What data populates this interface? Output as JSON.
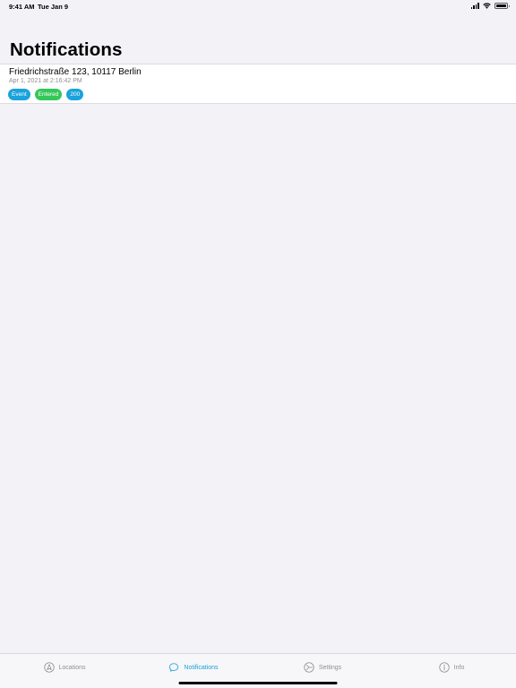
{
  "status_bar": {
    "time": "9:41 AM",
    "date": "Tue Jan 9"
  },
  "page": {
    "title": "Notifications"
  },
  "notifications": [
    {
      "title": "Friedrichstraße 123, 10117 Berlin",
      "subtitle": "Apr 1, 2021 at 2:16:42 PM",
      "badges": [
        {
          "label": "Event",
          "color": "#1aa3dc"
        },
        {
          "label": "Entered",
          "color": "#34c759"
        },
        {
          "label": "200",
          "color": "#1aa3dc"
        }
      ]
    }
  ],
  "tab_bar": {
    "active_color": "#1a9fd8",
    "inactive_color": "#8e8e93",
    "tabs": [
      {
        "label": "Locations",
        "icon": "location-arrow-icon",
        "active": false
      },
      {
        "label": "Notifications",
        "icon": "speech-bubble-icon",
        "active": true
      },
      {
        "label": "Settings",
        "icon": "settings-dial-icon",
        "active": false
      },
      {
        "label": "Info",
        "icon": "info-icon",
        "active": false
      }
    ]
  }
}
